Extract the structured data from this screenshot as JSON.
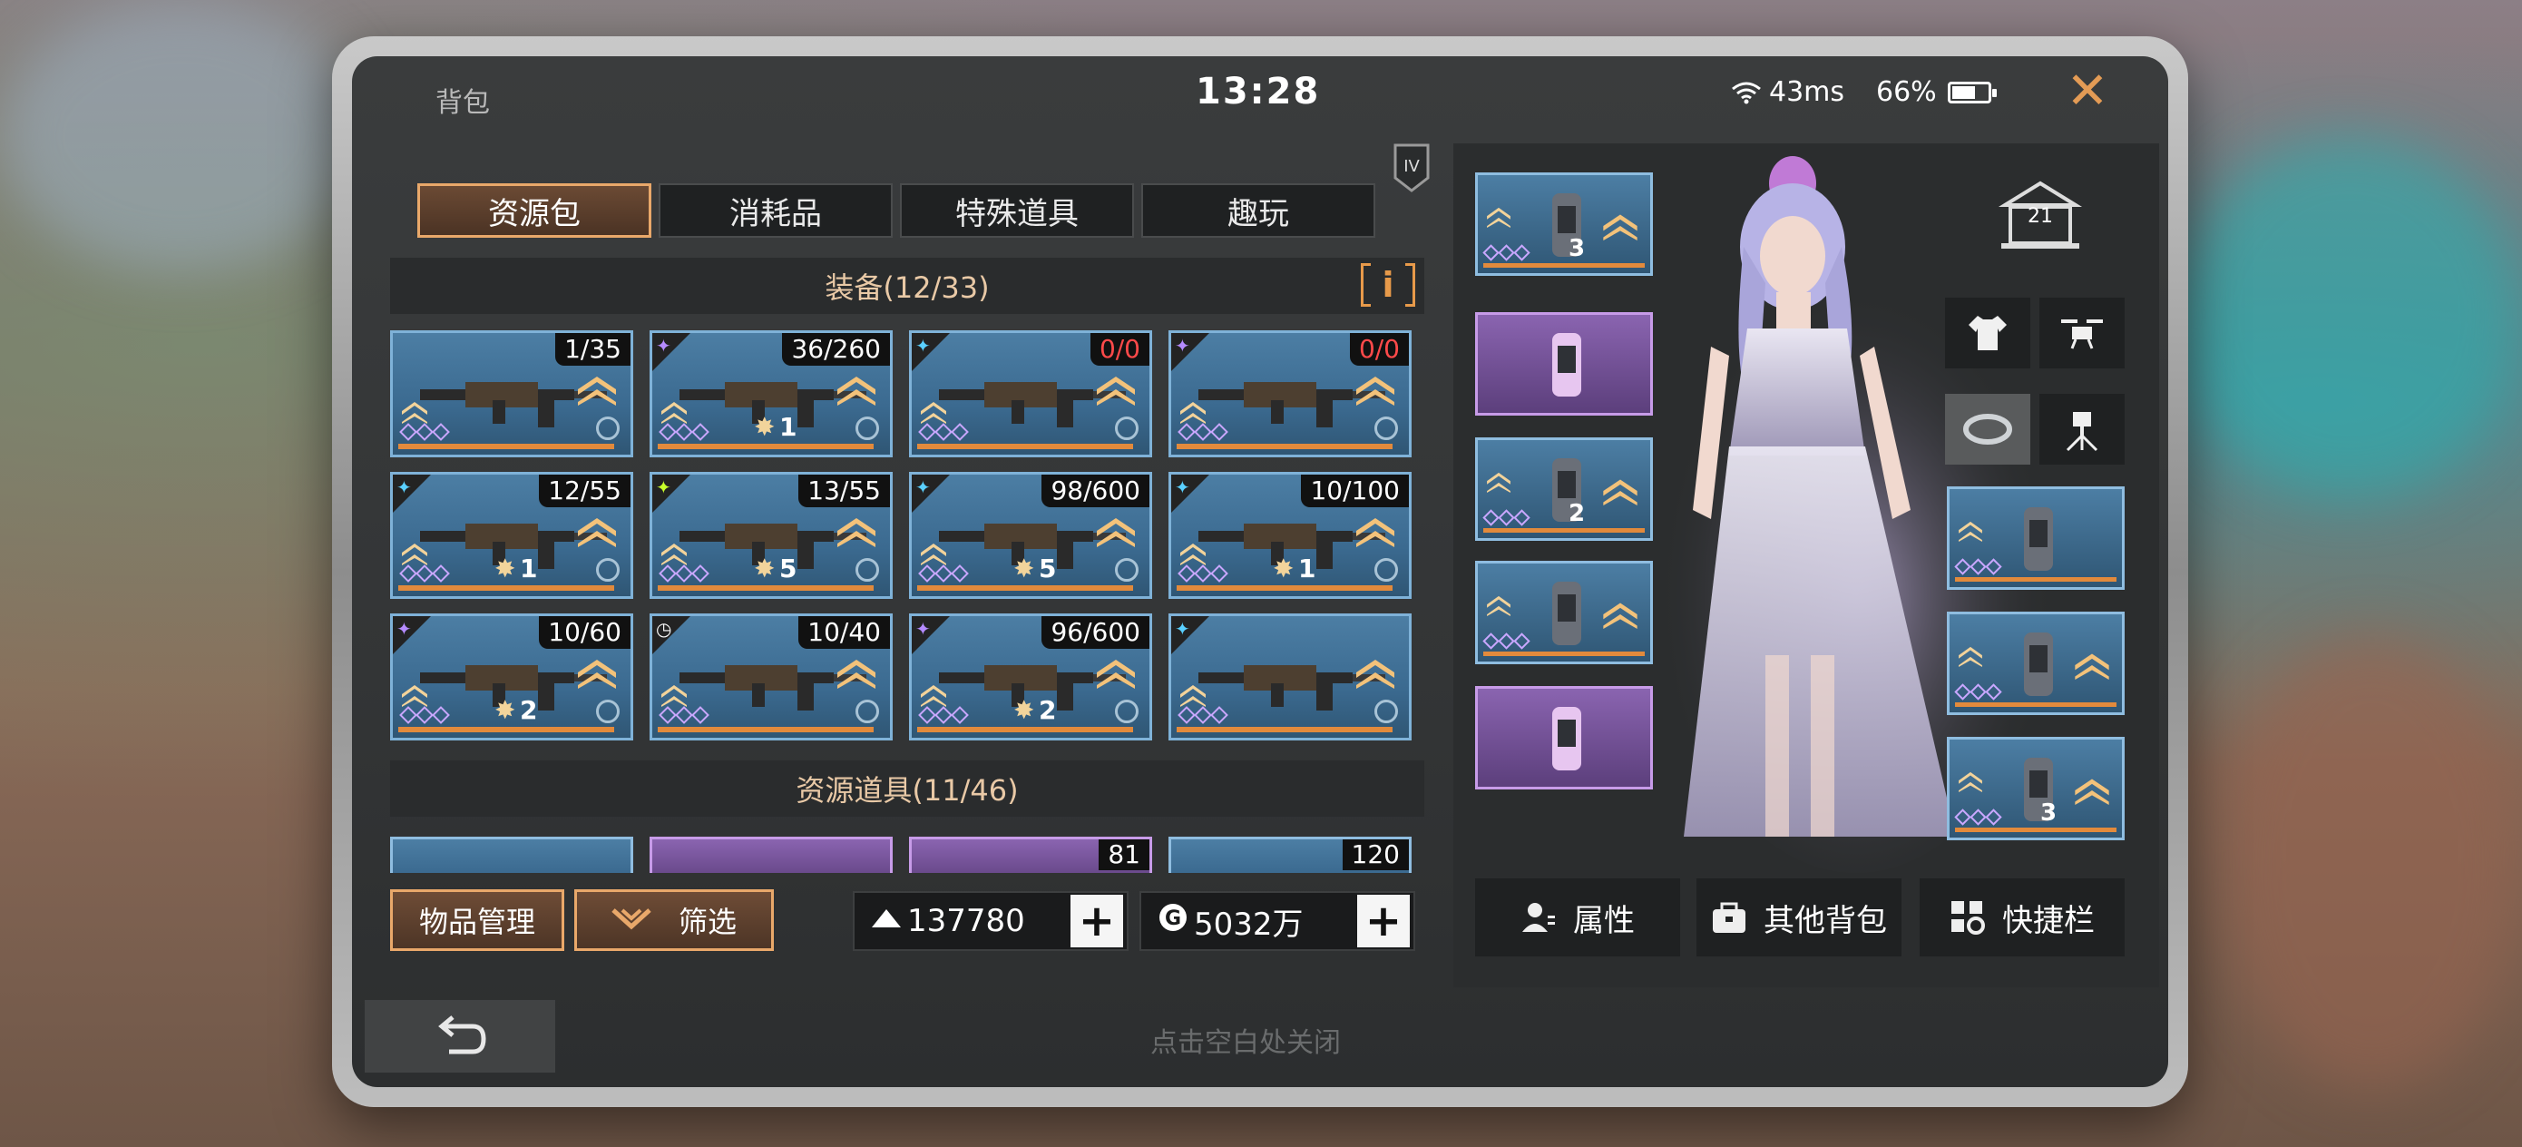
{
  "status": {
    "title": "背包",
    "time": "13:28",
    "ping": "43ms",
    "battery": "66%",
    "battery_level": 0.66
  },
  "tabs": [
    {
      "label": "资源包",
      "active": true
    },
    {
      "label": "消耗品",
      "active": false
    },
    {
      "label": "特殊道具",
      "active": false
    },
    {
      "label": "趣玩",
      "active": false
    }
  ],
  "tier_badge": "IV",
  "equipment_section": {
    "title": "装备(12/33)",
    "info_icon": "info-icon"
  },
  "equipment": [
    {
      "count": "1/35",
      "count_color": "normal",
      "level": "",
      "rarity": "",
      "progress": 0.95
    },
    {
      "count": "36/260",
      "count_color": "normal",
      "level": "1",
      "rarity": "purple",
      "progress": 0.95
    },
    {
      "count": "0/0",
      "count_color": "red",
      "level": "",
      "rarity": "blue",
      "progress": 0.95
    },
    {
      "count": "0/0",
      "count_color": "red",
      "level": "",
      "rarity": "purple",
      "progress": 0.95
    },
    {
      "count": "12/55",
      "count_color": "normal",
      "level": "1",
      "rarity": "blue",
      "progress": 0.95
    },
    {
      "count": "13/55",
      "count_color": "normal",
      "level": "5",
      "rarity": "yellow",
      "progress": 0.95
    },
    {
      "count": "98/600",
      "count_color": "normal",
      "level": "5",
      "rarity": "blue",
      "progress": 0.95
    },
    {
      "count": "10/100",
      "count_color": "normal",
      "level": "1",
      "rarity": "blue",
      "progress": 0.95
    },
    {
      "count": "10/60",
      "count_color": "normal",
      "level": "2",
      "rarity": "purple",
      "progress": 0.95
    },
    {
      "count": "10/40",
      "count_color": "normal",
      "level": "",
      "rarity": "timer",
      "progress": 0.95
    },
    {
      "count": "96/600",
      "count_color": "normal",
      "level": "2",
      "rarity": "purple",
      "progress": 0.95
    },
    {
      "count": "",
      "count_color": "normal",
      "level": "",
      "rarity": "blue",
      "progress": 0.95
    }
  ],
  "resource_section": {
    "title": "资源道具(11/46)"
  },
  "resources": [
    {
      "count": "",
      "color": "blue"
    },
    {
      "count": "",
      "color": "purple"
    },
    {
      "count": "81",
      "color": "purple"
    },
    {
      "count": "120",
      "color": "blue"
    }
  ],
  "buttons": {
    "manage": "物品管理",
    "filter": "筛选"
  },
  "currency": [
    {
      "icon": "crown-icon",
      "value": "137780",
      "plus": "+"
    },
    {
      "icon": "coin-icon",
      "value": "5032万",
      "plus": "+"
    }
  ],
  "hint": "点击空白处关闭",
  "character_panel": {
    "house_level": "21",
    "left_slots": [
      {
        "level": "3",
        "color": "blue",
        "upgrade": true
      },
      {
        "level": "",
        "color": "purple",
        "upgrade": false
      },
      {
        "level": "2",
        "color": "blue",
        "upgrade": true
      },
      {
        "level": "",
        "color": "blue",
        "upgrade": true
      },
      {
        "level": "",
        "color": "purple",
        "upgrade": false
      }
    ],
    "right_slots": [
      {
        "level": "",
        "color": "blue",
        "upgrade": false
      },
      {
        "level": "",
        "color": "blue",
        "upgrade": true
      },
      {
        "level": "3",
        "color": "blue",
        "upgrade": true
      }
    ],
    "quick_icons": [
      "shirt-icon",
      "drone-icon",
      "ring-icon",
      "turret-icon"
    ],
    "buttons": [
      {
        "icon": "person-card-icon",
        "label": "属性"
      },
      {
        "icon": "bag-icon",
        "label": "其他背包"
      },
      {
        "icon": "gear-grid-icon",
        "label": "快捷栏"
      }
    ]
  },
  "colors": {
    "accent": "#e9a86a",
    "blue_card": "#4c7ea4",
    "purple_card": "#8a64b0",
    "red": "#ff4a4a"
  }
}
